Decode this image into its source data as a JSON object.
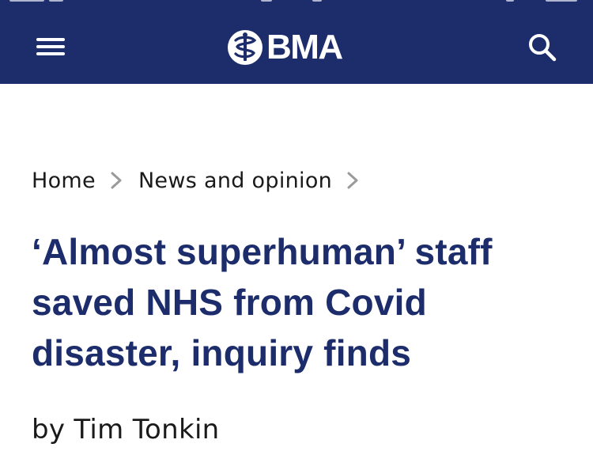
{
  "header": {
    "background_color": "#1d2d6b",
    "menu_icon": "hamburger-menu-icon",
    "logo": {
      "emblem_icon": "bma-emblem-icon",
      "text": "BMA"
    },
    "search_icon": "search-icon"
  },
  "breadcrumb": {
    "items": [
      {
        "label": "Home"
      },
      {
        "label": "News and opinion"
      }
    ],
    "separator_icon": "chevron-right-icon"
  },
  "article": {
    "title": "‘Almost superhuman’ staff saved NHS from Covid disaster, inquiry finds",
    "title_color": "#1d2d6b",
    "byline": "by Tim Tonkin"
  }
}
